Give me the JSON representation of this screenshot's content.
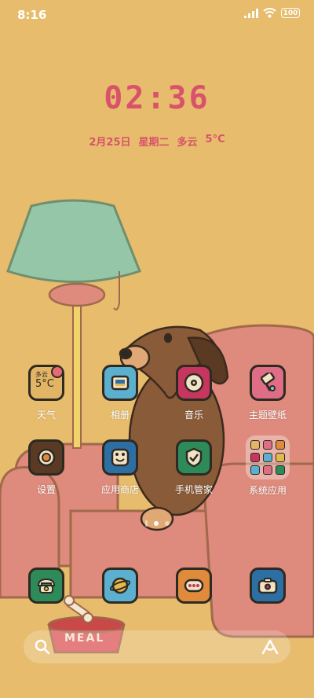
{
  "status_bar": {
    "time": "8:16",
    "battery": "100"
  },
  "clock": {
    "time": "02:36"
  },
  "date": {
    "day": "2月25日",
    "weekday": "星期二",
    "weather": "多云",
    "temp": "5°C"
  },
  "apps": [
    {
      "label": "天气",
      "weather_condition": "多云",
      "weather_temp": "5°C"
    },
    {
      "label": "相册"
    },
    {
      "label": "音乐"
    },
    {
      "label": "主题壁纸"
    },
    {
      "label": "设置"
    },
    {
      "label": "应用商店"
    },
    {
      "label": "手机管家"
    },
    {
      "label": "系统应用"
    }
  ],
  "dock": [
    "phone-icon",
    "browser-icon",
    "messages-icon",
    "camera-icon"
  ],
  "wallpaper": {
    "bowl_text": "MEAL"
  },
  "colors": {
    "background": "#E7BC6C",
    "accent": "#D8526B",
    "sofa": "#DE8A7C",
    "dog": "#8A5B38",
    "lamp_shade": "#96C6A8"
  }
}
